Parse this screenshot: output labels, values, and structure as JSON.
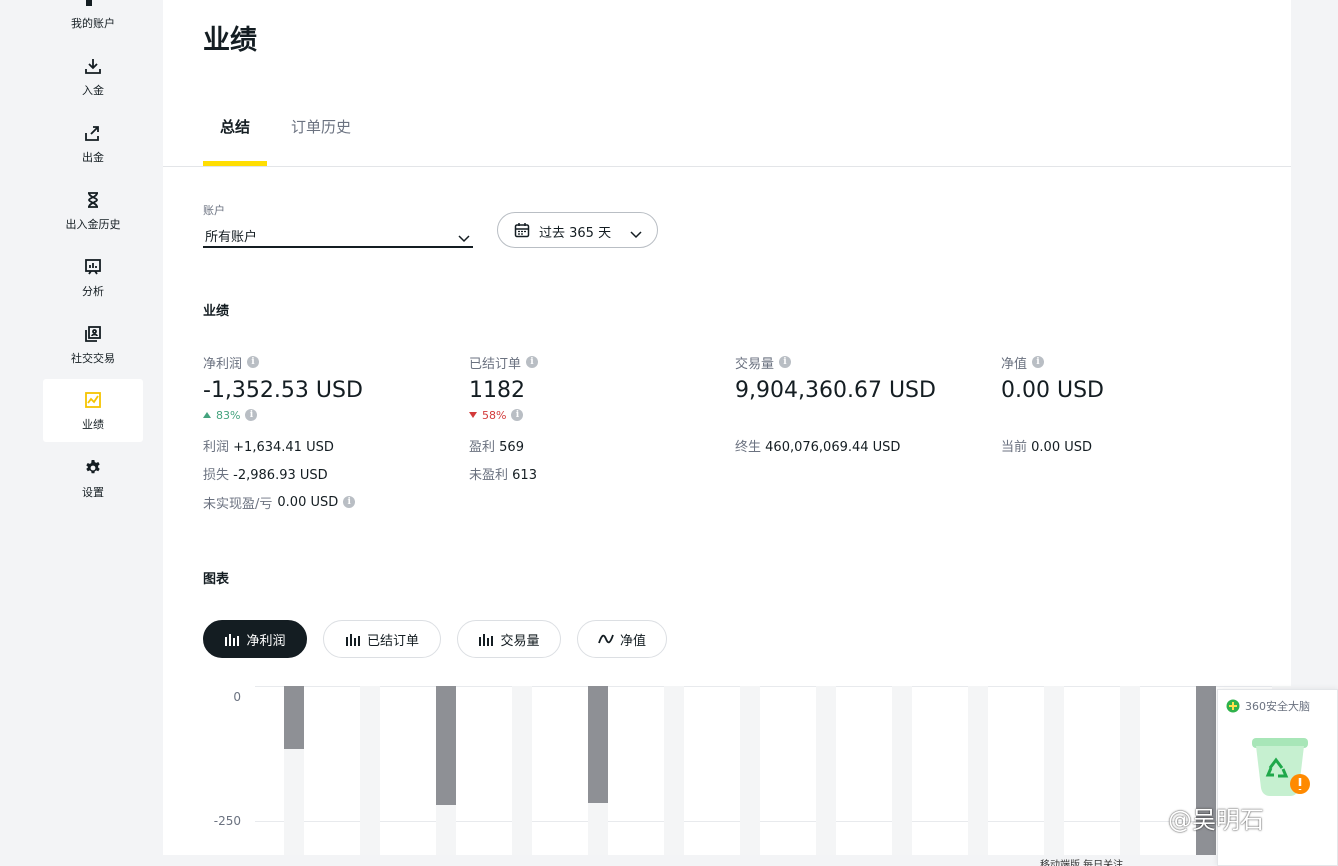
{
  "sidebar": {
    "items": [
      {
        "label": "我的账户",
        "icon": "account-icon",
        "active": false
      },
      {
        "label": "入金",
        "icon": "deposit-icon",
        "active": false
      },
      {
        "label": "出金",
        "icon": "withdraw-icon",
        "active": false
      },
      {
        "label": "出入金历史",
        "icon": "hourglass-icon",
        "active": false
      },
      {
        "label": "分析",
        "icon": "analytics-icon",
        "active": false
      },
      {
        "label": "社交交易",
        "icon": "social-trading-icon",
        "active": false
      },
      {
        "label": "业绩",
        "icon": "performance-icon",
        "active": true
      },
      {
        "label": "设置",
        "icon": "gear-icon",
        "active": false
      }
    ]
  },
  "page": {
    "title": "业绩",
    "tabs": [
      {
        "label": "总结",
        "active": true
      },
      {
        "label": "订单历史",
        "active": false
      }
    ]
  },
  "filters": {
    "account_label": "账户",
    "account_value": "所有账户",
    "date_range": "过去 365 天"
  },
  "performance": {
    "section_title": "业绩",
    "net_profit": {
      "label": "净利润",
      "value": "-1,352.53 USD",
      "change": "83%",
      "change_direction": "up",
      "profit_label": "利润",
      "profit_value": "+1,634.41 USD",
      "loss_label": "损失",
      "loss_value": "-2,986.93 USD",
      "unrealized_label": "未实现盈/亏",
      "unrealized_value": "0.00 USD"
    },
    "closed_orders": {
      "label": "已结订单",
      "value": "1182",
      "change": "58%",
      "change_direction": "down",
      "profitable_label": "盈利",
      "profitable_value": "569",
      "unprofitable_label": "未盈利",
      "unprofitable_value": "613"
    },
    "volume": {
      "label": "交易量",
      "value": "9,904,360.67 USD",
      "lifetime_label": "终生",
      "lifetime_value": "460,076,069.44 USD"
    },
    "equity": {
      "label": "净值",
      "value": "0.00 USD",
      "current_label": "当前",
      "current_value": "0.00 USD"
    }
  },
  "charts": {
    "section_title": "图表",
    "chips": [
      {
        "label": "净利润",
        "icon": "bar-chart-icon",
        "active": true
      },
      {
        "label": "已结订单",
        "icon": "bar-chart-icon",
        "active": false
      },
      {
        "label": "交易量",
        "icon": "bar-chart-icon",
        "active": false
      },
      {
        "label": "净值",
        "icon": "line-chart-icon",
        "active": false
      }
    ]
  },
  "chart_data": {
    "type": "bar",
    "y_ticks": [
      "0",
      "-250"
    ],
    "ylim_visible": [
      -340,
      0
    ],
    "values": [
      -128,
      null,
      -240,
      null,
      -236,
      null,
      null,
      null,
      null,
      null,
      null,
      null,
      -340,
      null,
      null,
      null,
      null
    ],
    "bar_color": "#8e9095",
    "grid": true
  },
  "overlay": {
    "widget_title": "360安全大脑",
    "watermark": "@吴明石",
    "bottom_text": "移动端版  每日关注"
  },
  "colors": {
    "accent": "#ffde02",
    "up": "#44a37e",
    "down": "#d33a3a",
    "text": "#141d22"
  }
}
